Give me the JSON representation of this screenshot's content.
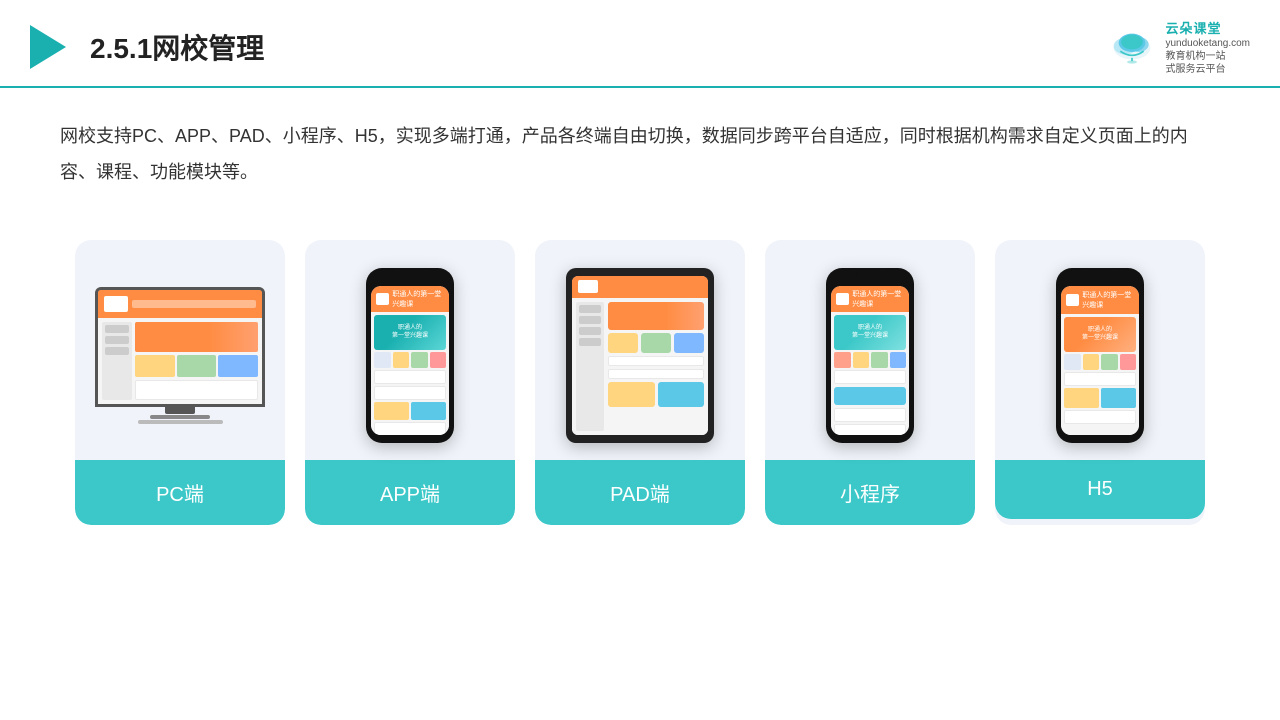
{
  "header": {
    "title": "2.5.1网校管理",
    "logo_name": "云朵课堂",
    "logo_sub_line1": "教育机构一站",
    "logo_sub_line2": "式服务云平台",
    "logo_domain": "yunduoketang.com"
  },
  "description": {
    "text": "网校支持PC、APP、PAD、小程序、H5，实现多端打通，产品各终端自由切换，数据同步跨平台自适应，同时根据机构需求自定义页面上的内容、课程、功能模块等。"
  },
  "cards": [
    {
      "id": "pc",
      "label": "PC端"
    },
    {
      "id": "app",
      "label": "APP端"
    },
    {
      "id": "pad",
      "label": "PAD端"
    },
    {
      "id": "miniprogram",
      "label": "小程序"
    },
    {
      "id": "h5",
      "label": "H5"
    }
  ],
  "colors": {
    "teal": "#3cc8c8",
    "dark_teal": "#1ab0b0",
    "orange": "#ff8c42",
    "border": "#1ab0b0"
  }
}
